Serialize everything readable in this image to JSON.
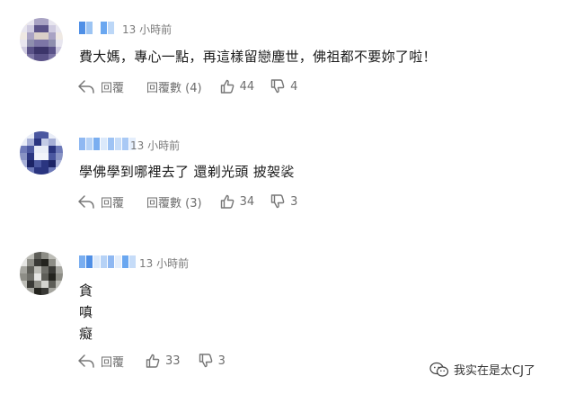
{
  "comments": [
    {
      "time": "13 小時前",
      "lines": [
        "費大媽，專心一點，再這樣留戀塵世，佛祖都不要妳了啦！"
      ],
      "reply_label": "回覆",
      "view_replies_label": "回覆數 (4)",
      "likes": "44",
      "dislikes": "4"
    },
    {
      "time": "13 小時前",
      "lines": [
        "學佛學到哪裡去了 還剃光頭 披袈裟"
      ],
      "reply_label": "回覆",
      "view_replies_label": "回覆數 (3)",
      "likes": "34",
      "dislikes": "3"
    },
    {
      "time": "13 小時前",
      "lines": [
        "貪",
        "嗔",
        "癡"
      ],
      "reply_label": "回覆",
      "likes": "33",
      "dislikes": "3"
    }
  ],
  "watermark": {
    "text": "我实在是太CJ了"
  },
  "icons": {
    "reply": "reply-arrow-icon",
    "like": "thumbs-up-icon",
    "dislike": "thumbs-down-icon",
    "watermark": "wechat-icon"
  },
  "colors": {
    "meta_text": "#7a7a7a",
    "action_text": "#6e6e6e",
    "body_text": "#1a1a1a"
  }
}
